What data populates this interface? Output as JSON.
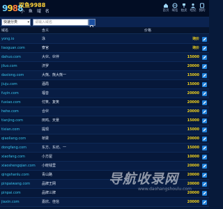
{
  "header": {
    "logo_mark": "9988",
    "logo_title": "双鱼9988",
    "logo_subtitle": "小 鱼 域 名",
    "nav": [
      {
        "label": "首页",
        "icon": "home-icon"
      },
      {
        "label": "域名",
        "icon": "globe-icon"
      },
      {
        "label": "拍卖",
        "icon": "gavel-icon"
      },
      {
        "label": "经纪",
        "icon": "user-icon"
      },
      {
        "label": "我的",
        "icon": "person-icon"
      }
    ]
  },
  "filter": {
    "select_value": "快速分类",
    "search_placeholder": "请输入域名"
  },
  "table": {
    "columns": {
      "domain": "域名",
      "meaning": "含义",
      "price": "价格"
    },
    "rows": [
      {
        "domain": "yong.io",
        "meaning": "泳",
        "price": "询价"
      },
      {
        "domain": "liaoguan.com",
        "meaning": "寮官",
        "price": "询价"
      },
      {
        "domain": "dahuo.com",
        "meaning": "大伙、伙伴",
        "price": "15000"
      },
      {
        "domain": "jiluo.com",
        "meaning": "济罗",
        "price": "20000"
      },
      {
        "domain": "daxiong.com",
        "meaning": "大熊、熊大熊一",
        "price": "15000"
      },
      {
        "domain": "jiuju.com",
        "meaning": "酒局",
        "price": "15000"
      },
      {
        "domain": "fuyin.com",
        "meaning": "福音",
        "price": "20000"
      },
      {
        "domain": "fuxiao.com",
        "meaning": "付笑、复笑",
        "price": "20000"
      },
      {
        "domain": "hehe.com",
        "meaning": "合伙",
        "price": "20000"
      },
      {
        "domain": "tianjing.com",
        "meaning": "田鸡、天景",
        "price": "15000"
      },
      {
        "domain": "tixian.com",
        "meaning": "提现",
        "price": "15000"
      },
      {
        "domain": "qiaoliang.com",
        "meaning": "桥梁",
        "price": "20000"
      },
      {
        "domain": "dongfang.com",
        "meaning": "东方、东坊、一",
        "price": "15000"
      },
      {
        "domain": "xiaofang.com",
        "meaning": "小方屋",
        "price": "10000"
      },
      {
        "domain": "xiaoshengqian.com",
        "meaning": "小晓钱里",
        "price": "20000"
      },
      {
        "domain": "qingshanlu.com",
        "meaning": "青山路",
        "price": "20000"
      },
      {
        "domain": "pinpaiwang.com",
        "meaning": "品牌王网",
        "price": "20000"
      },
      {
        "domain": "pinpai.com",
        "meaning": "品牌三牌",
        "price": "20000"
      },
      {
        "domain": "jiaxin.com",
        "meaning": "嘉欣、佳信",
        "price": "20000"
      }
    ]
  },
  "watermark": {
    "text": "导航收录网",
    "url": "www.daohangshoulu.com"
  },
  "colors": {
    "background": "#071a3a",
    "domain_text": "#37c6f0",
    "price_text": "#f2d21c",
    "buy_button": "#1f7fd8"
  }
}
